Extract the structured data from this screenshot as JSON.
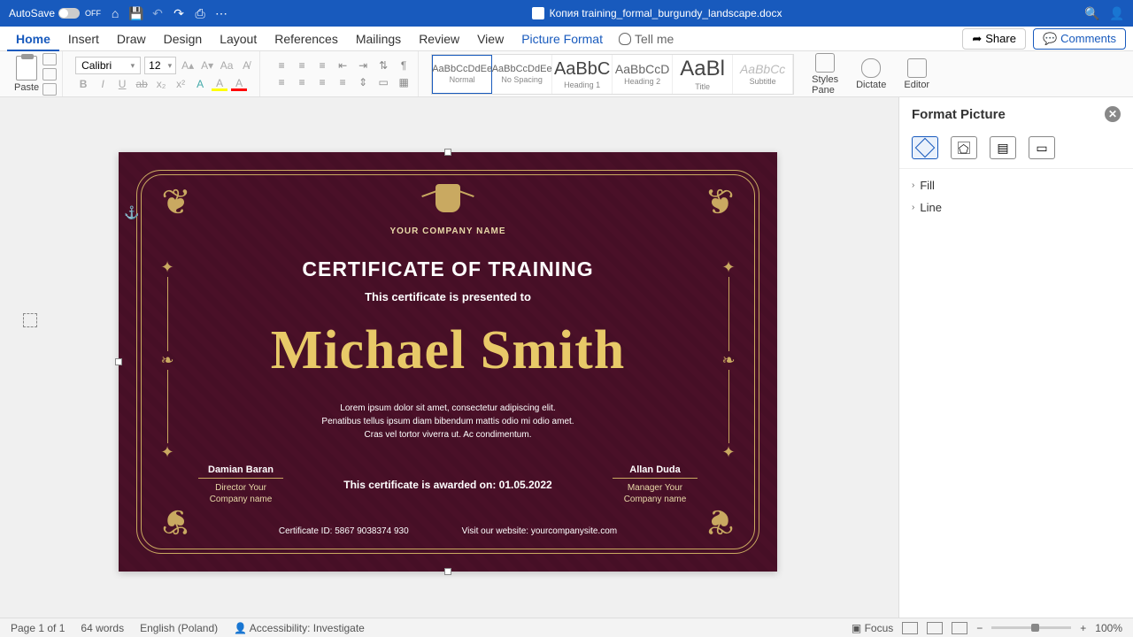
{
  "titlebar": {
    "autosave": "AutoSave",
    "autosave_state": "OFF",
    "filename": "Копия training_formal_burgundy_landscape.docx"
  },
  "tabs": {
    "home": "Home",
    "insert": "Insert",
    "draw": "Draw",
    "design": "Design",
    "layout": "Layout",
    "references": "References",
    "mailings": "Mailings",
    "review": "Review",
    "view": "View",
    "picture_format": "Picture Format",
    "tell_me": "Tell me"
  },
  "header_buttons": {
    "share": "Share",
    "comments": "Comments"
  },
  "ribbon": {
    "paste": "Paste",
    "font_name": "Calibri",
    "font_size": "12",
    "styles": {
      "normal_prev": "AaBbCcDdEe",
      "normal": "Normal",
      "nospacing_prev": "AaBbCcDdEe",
      "nospacing": "No Spacing",
      "h1_prev": "AaBbC",
      "h1": "Heading 1",
      "h2_prev": "AaBbCcD",
      "h2": "Heading 2",
      "title_prev": "AaBl",
      "title": "Title",
      "subtitle_prev": "AaBbCc",
      "subtitle": "Subtitle"
    },
    "styles_pane": "Styles\nPane",
    "dictate": "Dictate",
    "editor": "Editor"
  },
  "cert": {
    "company": "YOUR COMPANY NAME",
    "title": "CERTIFICATE OF TRAINING",
    "presented": "This certificate is presented to",
    "name": "Michael Smith",
    "lorem1": "Lorem ipsum dolor sit amet, consectetur adipiscing elit.",
    "lorem2": "Penatibus tellus ipsum diam bibendum mattis odio mi odio amet.",
    "lorem3": "Cras vel tortor viverra ut. Ac condimentum.",
    "sig1_name": "Damian Baran",
    "sig1_role": "Director Your\nCompany name",
    "sig2_name": "Allan Duda",
    "sig2_role": "Manager Your\nCompany name",
    "awarded": "This certificate is awarded on: 01.05.2022",
    "cert_id": "Certificate ID: 5867 9038374 930",
    "website": "Visit our website: yourcompanysite.com"
  },
  "pane": {
    "title": "Format Picture",
    "fill": "Fill",
    "line": "Line"
  },
  "status": {
    "page": "Page 1 of 1",
    "words": "64 words",
    "lang": "English (Poland)",
    "access": "Accessibility: Investigate",
    "focus": "Focus",
    "zoom": "100%"
  }
}
